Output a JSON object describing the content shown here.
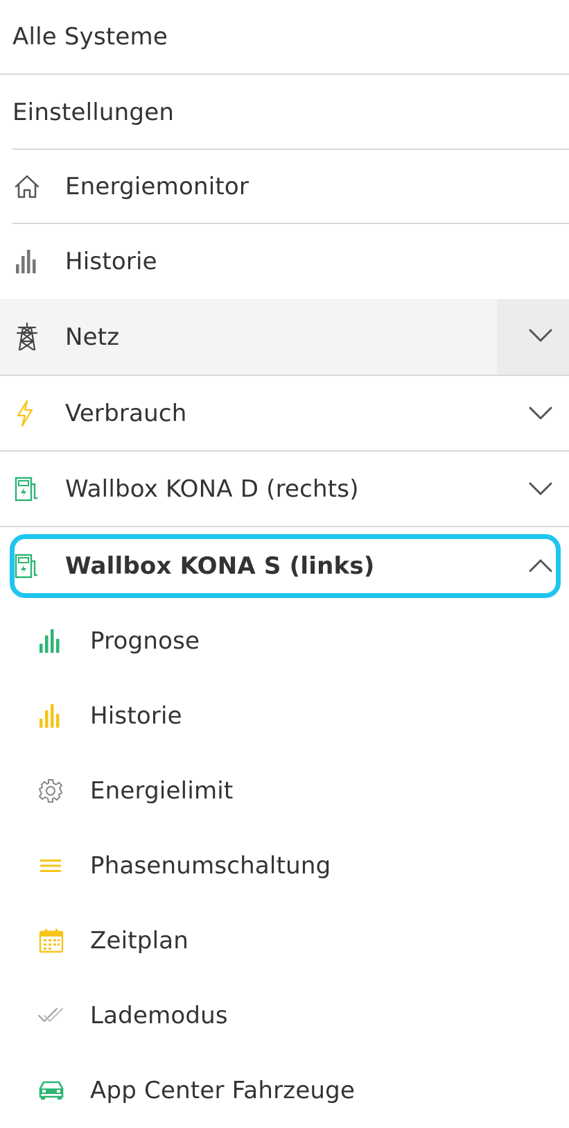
{
  "menu": {
    "all_systems": "Alle Systeme",
    "settings": "Einstellungen",
    "energy_monitor": "Energiemonitor",
    "history": "Historie",
    "grid": "Netz",
    "consumption": "Verbrauch",
    "wallbox_d": "Wallbox KONA D (rechts)",
    "wallbox_s": "Wallbox KONA S (links)"
  },
  "submenu": {
    "forecast": "Prognose",
    "history": "Historie",
    "energy_limit": "Energielimit",
    "phase_switching": "Phasenumschaltung",
    "schedule": "Zeitplan",
    "charging_mode": "Lademodus",
    "app_center": "App Center Fahrzeuge"
  },
  "colors": {
    "highlight": "#1ec5ee",
    "green": "#2bb673",
    "yellow": "#f5c518",
    "icon_gray": "#777777",
    "text": "#333333"
  },
  "icons": {
    "energy_monitor": "home-icon",
    "history": "bar-chart-icon",
    "grid": "power-tower-icon",
    "consumption": "lightning-icon",
    "wallbox_d": "ev-charger-icon",
    "wallbox_s": "ev-charger-icon",
    "forecast": "bar-chart-icon",
    "sub_history": "bar-chart-icon",
    "energy_limit": "gear-icon",
    "phase_switching": "menu-lines-icon",
    "schedule": "calendar-icon",
    "charging_mode": "checkmarks-icon",
    "app_center": "car-icon"
  }
}
